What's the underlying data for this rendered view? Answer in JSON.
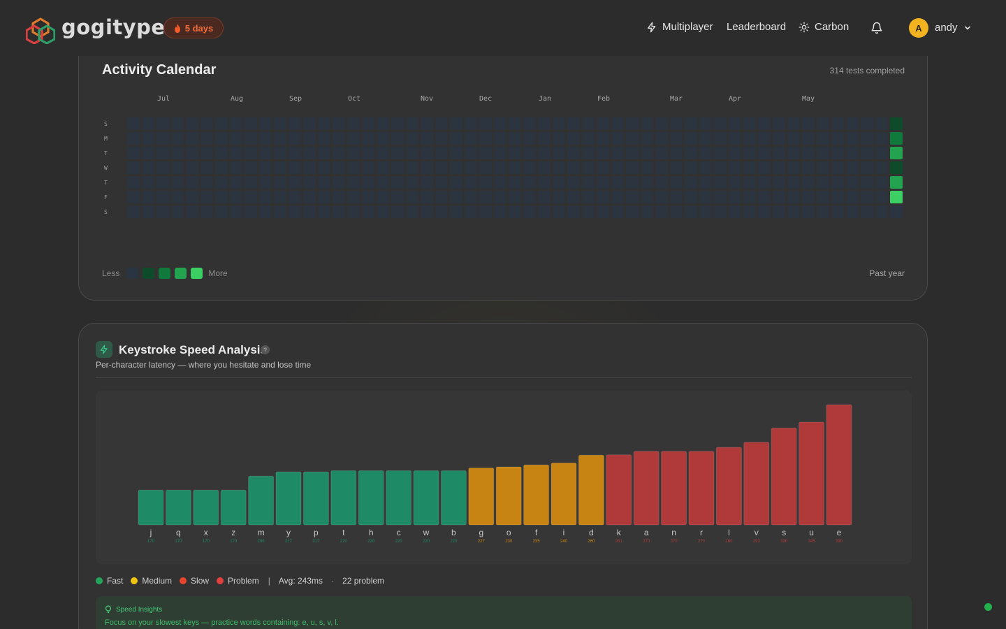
{
  "header": {
    "brand": "gogitype",
    "streak_label": "5 days",
    "nav": {
      "multiplayer": "Multiplayer",
      "leaderboard": "Leaderboard",
      "theme": "Carbon"
    },
    "user": {
      "initial": "A",
      "name": "andy"
    }
  },
  "activity": {
    "title": "Activity Calendar",
    "count_text": "314 tests completed",
    "months": [
      "Jul",
      "Aug",
      "Sep",
      "Oct",
      "Nov",
      "Dec",
      "Jan",
      "Feb",
      "Mar",
      "Apr",
      "May"
    ],
    "days": [
      "S",
      "M",
      "T",
      "W",
      "T",
      "F",
      "S"
    ],
    "last_week_levels": [
      1,
      2,
      3,
      1,
      3,
      4,
      0
    ],
    "legend_less": "Less",
    "legend_more": "More",
    "period": "Past year",
    "colors": {
      "empty": "#2b3441",
      "l1": "#0e4b2a",
      "l2": "#0f7a3c",
      "l3": "#23a24f",
      "l4": "#3ccf63"
    }
  },
  "keystroke": {
    "title": "Keystroke Speed Analysis",
    "help": "?",
    "subtitle": "Per-character latency — where you hesitate and lose time",
    "legend": {
      "fast": "Fast",
      "medium": "Medium",
      "slow": "Slow",
      "problem": "Problem",
      "avg": "Avg: 243ms",
      "problem_count": "22 problem",
      "sep1": "|",
      "sep2": "·"
    },
    "colors": {
      "fast": "#1f8a66",
      "medium": "#c88412",
      "problem": "#b03a3a",
      "dot_fast": "#22a55a",
      "dot_medium": "#f1c40f",
      "dot_slow": "#e8452c",
      "dot_problem": "#e34040"
    },
    "insight_title": "Speed Insights",
    "insight_text": "Focus on your slowest keys — practice words containing: e, u, s, v, l."
  },
  "chart_data": {
    "type": "bar",
    "categories": [
      "j",
      "q",
      "x",
      "z",
      "m",
      "y",
      "p",
      "t",
      "h",
      "c",
      "w",
      "b",
      "g",
      "o",
      "f",
      "i",
      "d",
      "k",
      "a",
      "n",
      "r",
      "l",
      "v",
      "s",
      "u",
      "e"
    ],
    "values": [
      170,
      170,
      170,
      170,
      206,
      217,
      217,
      220,
      220,
      220,
      220,
      220,
      227,
      230,
      235,
      240,
      260,
      261,
      270,
      270,
      270,
      280,
      293,
      330,
      345,
      390
    ],
    "value_labels": [
      "170",
      "170",
      "170",
      "170",
      "206",
      "217",
      "217",
      "220",
      "220",
      "220",
      "220",
      "220",
      "227",
      "230",
      "235",
      "240",
      "260",
      "261",
      "270",
      "270",
      "270",
      "280",
      "293",
      "330",
      "345",
      "390"
    ],
    "categories_class": [
      "fast",
      "fast",
      "fast",
      "fast",
      "fast",
      "fast",
      "fast",
      "fast",
      "fast",
      "fast",
      "fast",
      "fast",
      "medium",
      "medium",
      "medium",
      "medium",
      "medium",
      "problem",
      "problem",
      "problem",
      "problem",
      "problem",
      "problem",
      "problem",
      "problem",
      "problem"
    ],
    "unit": "ms",
    "xlabel": "",
    "ylabel": "",
    "ylim": [
      0,
      400
    ]
  }
}
